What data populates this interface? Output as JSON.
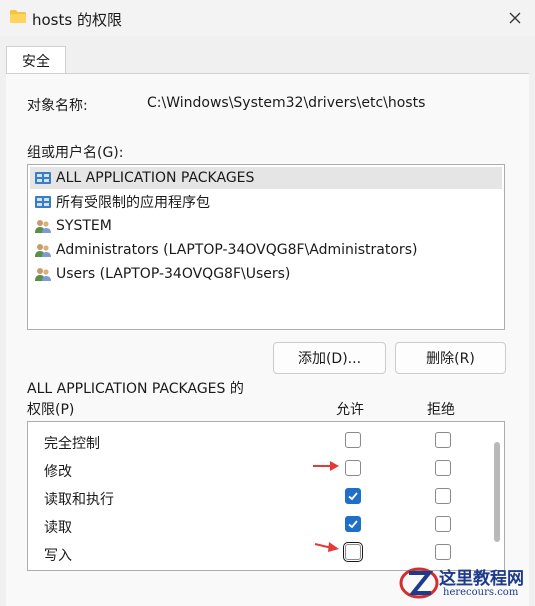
{
  "window": {
    "title": "hosts 的权限"
  },
  "tabs": [
    {
      "label": "安全"
    }
  ],
  "object": {
    "label": "对象名称:",
    "value": "C:\\Windows\\System32\\drivers\\etc\\hosts"
  },
  "groups": {
    "label": "组或用户名(G):",
    "items": [
      {
        "name": "ALL APPLICATION PACKAGES",
        "icon": "package-icon",
        "selected": true
      },
      {
        "name": "所有受限制的应用程序包",
        "icon": "package-icon",
        "selected": false
      },
      {
        "name": "SYSTEM",
        "icon": "users-icon",
        "selected": false
      },
      {
        "name": "Administrators (LAPTOP-34OVQG8F\\Administrators)",
        "icon": "users-icon",
        "selected": false
      },
      {
        "name": "Users (LAPTOP-34OVQG8F\\Users)",
        "icon": "users-icon",
        "selected": false
      }
    ]
  },
  "buttons": {
    "add": "添加(D)...",
    "remove": "删除(R)"
  },
  "permissions": {
    "title": "ALL APPLICATION PACKAGES 的",
    "label": "权限(P)",
    "allow_header": "允许",
    "deny_header": "拒绝",
    "rows": [
      {
        "name": "完全控制",
        "allow": false,
        "deny": false
      },
      {
        "name": "修改",
        "allow": false,
        "deny": false
      },
      {
        "name": "读取和执行",
        "allow": true,
        "deny": false
      },
      {
        "name": "读取",
        "allow": true,
        "deny": false
      },
      {
        "name": "写入",
        "allow": false,
        "deny": false
      }
    ]
  },
  "watermark": {
    "text": "这里教程网",
    "url": "herecours.com",
    "color": "#1e3a8a",
    "accent": "#d32f2f"
  },
  "colors": {
    "checkbox_checked": "#1f6fc9",
    "annotation_arrow": "#e53935"
  }
}
